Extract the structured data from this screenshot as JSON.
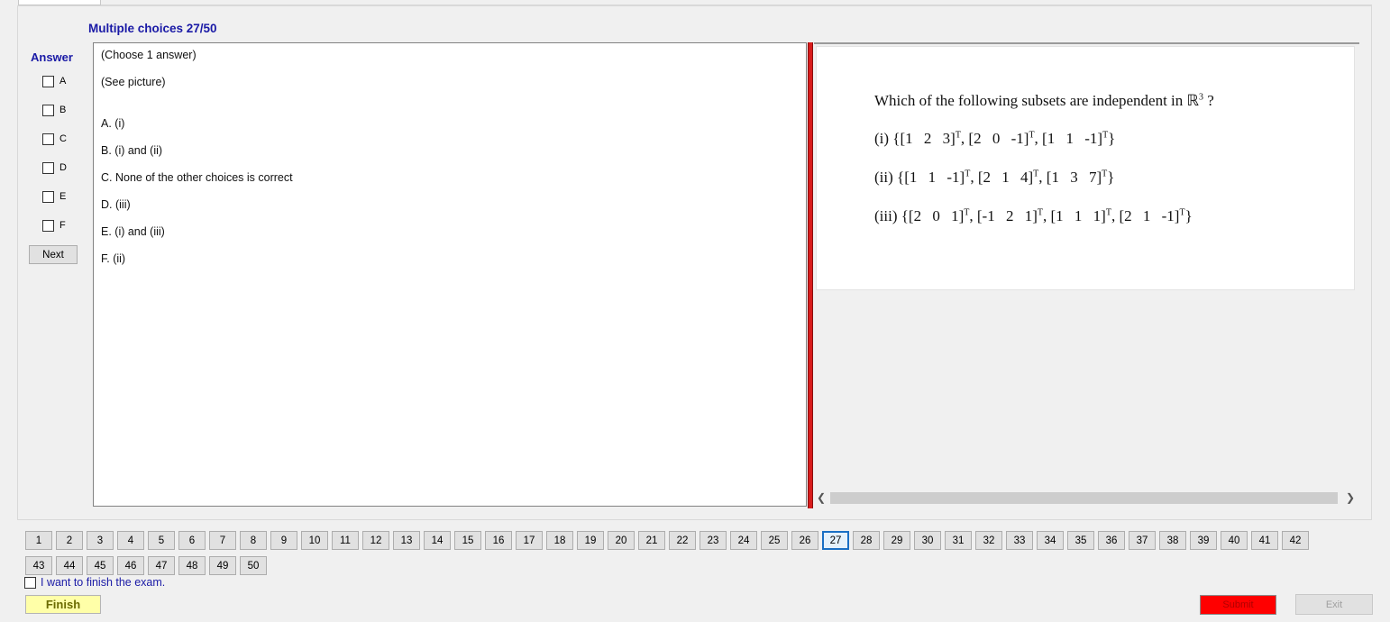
{
  "header": {
    "title": "Multiple choices 27/50"
  },
  "answer": {
    "label": "Answer",
    "options": [
      "A",
      "B",
      "C",
      "D",
      "E",
      "F"
    ],
    "next_label": "Next"
  },
  "choices": {
    "instruction": "(Choose 1 answer)",
    "see_picture": "(See picture)",
    "items": [
      "A. (i)",
      "B. (i) and (ii)",
      "C. None of the other choices is correct",
      "D. (iii)",
      "E. (i) and (iii)",
      "F. (ii)"
    ]
  },
  "picture": {
    "question": "Which of the following subsets are independent in",
    "space": "ℝ",
    "exp": "3",
    "question_end": " ?",
    "items": [
      {
        "label": "(i)",
        "vectors": [
          [
            "1 2 3",
            "T"
          ],
          [
            "2 0 -1",
            "T"
          ],
          [
            "1 1 -1",
            "T"
          ]
        ]
      },
      {
        "label": "(ii)",
        "vectors": [
          [
            "1 1 -1",
            "T"
          ],
          [
            "2 1 4",
            "T"
          ],
          [
            "1 3 7",
            "T"
          ]
        ]
      },
      {
        "label": "(iii)",
        "vectors": [
          [
            "2 0 1",
            "T"
          ],
          [
            "-1 2 1",
            "T"
          ],
          [
            "1 1 1",
            "T"
          ],
          [
            "2 1 -1",
            "T"
          ]
        ]
      }
    ]
  },
  "nav": {
    "questions": [
      "1",
      "2",
      "3",
      "4",
      "5",
      "6",
      "7",
      "8",
      "9",
      "10",
      "11",
      "12",
      "13",
      "14",
      "15",
      "16",
      "17",
      "18",
      "19",
      "20",
      "21",
      "22",
      "23",
      "24",
      "25",
      "26",
      "27",
      "28",
      "29",
      "30",
      "31",
      "32",
      "33",
      "34",
      "35",
      "36",
      "37",
      "38",
      "39",
      "40",
      "41",
      "42",
      "43",
      "44",
      "45",
      "46",
      "47",
      "48",
      "49",
      "50"
    ],
    "current": "27"
  },
  "footer": {
    "finish_check_label": "I want to finish the exam.",
    "finish_label": "Finish",
    "submit_label": "Submit",
    "exit_label": "Exit"
  }
}
